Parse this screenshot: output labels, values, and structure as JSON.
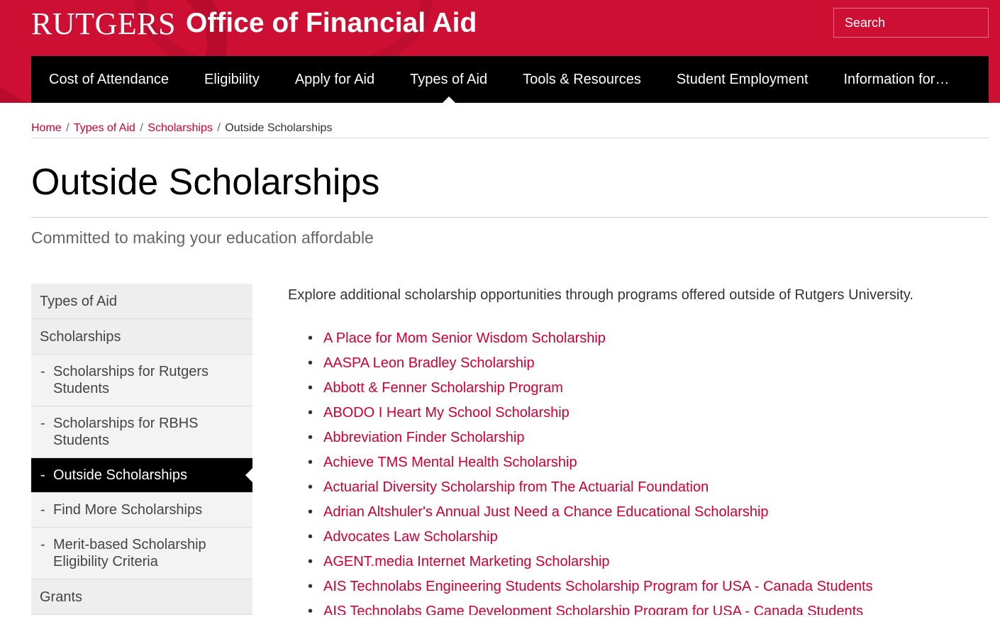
{
  "header": {
    "logo_text": "RUTGERS",
    "site_title": "Office of Financial Aid",
    "search_placeholder": "Search"
  },
  "nav": {
    "items": [
      {
        "label": "Cost of Attendance"
      },
      {
        "label": "Eligibility"
      },
      {
        "label": "Apply for Aid"
      },
      {
        "label": "Types of Aid",
        "active": true
      },
      {
        "label": "Tools & Resources"
      },
      {
        "label": "Student Employment"
      },
      {
        "label": "Information for…"
      }
    ]
  },
  "breadcrumb": {
    "home": "Home",
    "types_of_aid": "Types of Aid",
    "scholarships": "Scholarships",
    "current": "Outside Scholarships",
    "separator": "/"
  },
  "page": {
    "title": "Outside Scholarships",
    "tagline": "Committed to making your education affordable"
  },
  "sidebar": {
    "items": [
      {
        "label": "Types of Aid",
        "level": "top"
      },
      {
        "label": "Scholarships",
        "level": "top"
      },
      {
        "label": "Scholarships for Rutgers Students",
        "level": "sub"
      },
      {
        "label": "Scholarships for RBHS Students",
        "level": "sub"
      },
      {
        "label": "Outside Scholarships",
        "level": "sub",
        "active": true
      },
      {
        "label": "Find More Scholarships",
        "level": "sub"
      },
      {
        "label": "Merit-based Scholarship Eligibility Criteria",
        "level": "sub"
      },
      {
        "label": "Grants",
        "level": "top"
      }
    ]
  },
  "main": {
    "intro": "Explore additional scholarship opportunities through programs offered outside of Rutgers University.",
    "scholarships": [
      "A Place for Mom Senior Wisdom Scholarship",
      "AASPA Leon Bradley Scholarship",
      "Abbott & Fenner Scholarship Program",
      "ABODO I Heart My School Scholarship",
      "Abbreviation Finder Scholarship",
      "Achieve TMS Mental Health Scholarship",
      "Actuarial Diversity Scholarship from The Actuarial Foundation",
      "Adrian Altshuler's Annual Just Need a Chance Educational Scholarship",
      "Advocates Law Scholarship",
      "AGENT.media Internet Marketing Scholarship",
      "AIS Technolabs Engineering Students Scholarship Program for USA - Canada Students",
      "AIS Technolabs Game Development Scholarship Program for USA - Canada Students"
    ]
  },
  "colors": {
    "brand_red": "#cc0f33",
    "link_red": "#cc0033",
    "nav_black": "#000000",
    "sidebar_gray": "#eeeeee"
  }
}
